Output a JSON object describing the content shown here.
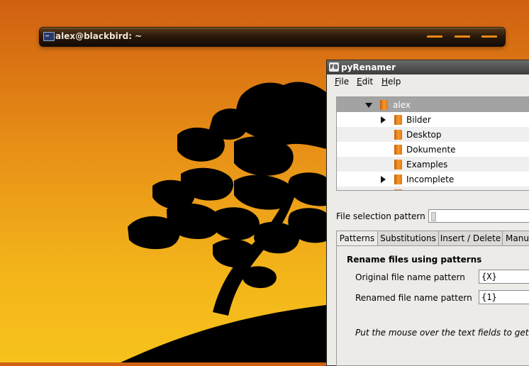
{
  "terminal": {
    "title": "alex@blackbird: ~",
    "icon": "terminal-icon",
    "accent": "#f08a18"
  },
  "pyrenamer": {
    "title": "pyRenamer",
    "app_icon": "pyrenamer-app-icon",
    "menu": [
      {
        "label": "File",
        "mnemonic": "F",
        "rest": "ile"
      },
      {
        "label": "Edit",
        "mnemonic": "E",
        "rest": "dit"
      },
      {
        "label": "Help",
        "mnemonic": "H",
        "rest": "elp"
      }
    ],
    "tree": {
      "items": [
        {
          "label": "alex",
          "expander": "expanded",
          "selected": true
        },
        {
          "label": "Bilder",
          "expander": "collapsed"
        },
        {
          "label": "Desktop",
          "expander": "none"
        },
        {
          "label": "Dokumente",
          "expander": "none"
        },
        {
          "label": "Examples",
          "expander": "none"
        },
        {
          "label": "Incomplete",
          "expander": "collapsed"
        }
      ]
    },
    "file_selection": {
      "label": "File selection pattern",
      "value": ""
    },
    "tabs": [
      {
        "label": "Patterns",
        "active": true
      },
      {
        "label": "Substitutions",
        "active": false
      },
      {
        "label": "Insert / Delete",
        "active": false
      },
      {
        "label": "Manua",
        "active": false
      }
    ],
    "patterns_panel": {
      "heading": "Rename files using patterns",
      "original_label": "Original file name pattern",
      "original_value": "{X}",
      "renamed_label": "Renamed file name pattern",
      "renamed_value": "{1}",
      "hint": "Put the mouse over the text fields to get he"
    },
    "colors": {
      "folder": "#e8801a",
      "selection": "#a3a3a3"
    }
  }
}
